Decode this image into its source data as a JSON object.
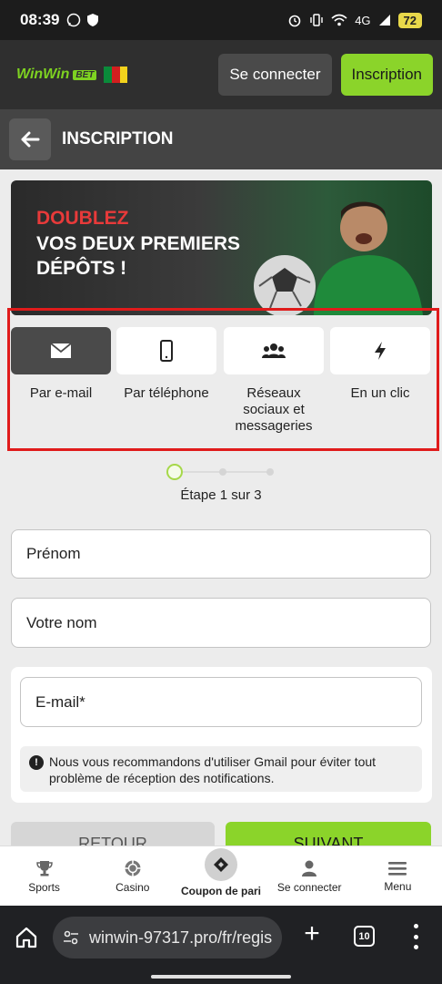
{
  "status_bar": {
    "time": "08:39",
    "network": "4G",
    "battery": "72"
  },
  "header": {
    "logo_text": "WinWin",
    "logo_badge": "BET",
    "login_label": "Se connecter",
    "register_label": "Inscription"
  },
  "page": {
    "title": "INSCRIPTION"
  },
  "banner": {
    "line1": "DOUBLEZ",
    "line2": "VOS DEUX PREMIERS DÉPÔTS !"
  },
  "methods": [
    {
      "label": "Par e-mail",
      "icon": "envelope-icon",
      "active": true
    },
    {
      "label": "Par téléphone",
      "icon": "phone-icon",
      "active": false
    },
    {
      "label": "Réseaux sociaux et messageries",
      "icon": "users-icon",
      "active": false
    },
    {
      "label": "En un clic",
      "icon": "lightning-icon",
      "active": false
    }
  ],
  "stepper": {
    "current": 1,
    "total": 3,
    "text": "Étape 1 sur 3"
  },
  "form": {
    "first_name_placeholder": "Prénom",
    "last_name_placeholder": "Votre nom",
    "email_placeholder": "E-mail*",
    "notice": "Nous vous recommandons d'utiliser Gmail pour éviter tout problème de réception des notifications."
  },
  "actions": {
    "back_label": "RETOUR",
    "next_label": "SUIVANT"
  },
  "bottom_nav": [
    {
      "label": "Sports",
      "icon": "trophy-icon"
    },
    {
      "label": "Casino",
      "icon": "chip-icon"
    },
    {
      "label": "Coupon de pari",
      "icon": "ticket-icon"
    },
    {
      "label": "Se connecter",
      "icon": "user-icon"
    },
    {
      "label": "Menu",
      "icon": "menu-icon"
    }
  ],
  "browser": {
    "url": "winwin-97317.pro/fr/regis",
    "tab_count": "10"
  },
  "colors": {
    "accent_green": "#8bd42a",
    "highlight_red": "#e01b1b",
    "header_dark": "#2f2f2f"
  }
}
